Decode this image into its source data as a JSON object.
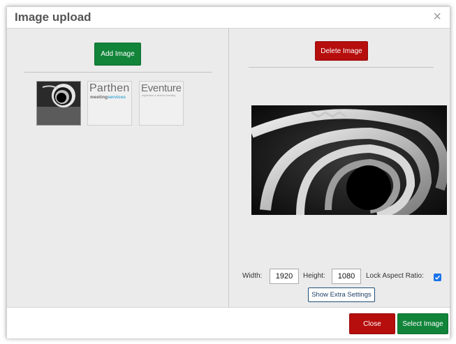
{
  "dialog": {
    "title": "Image upload",
    "close_symbol": "×"
  },
  "left": {
    "add_button": "Add Image",
    "thumbnails": [
      {
        "name": "spiral",
        "selected": true
      },
      {
        "name": "parthen",
        "line1": "Parthen",
        "line2a": "meeting",
        "line2b": "services"
      },
      {
        "name": "eventure",
        "line1": "Eventure",
        "line2": "registration & abstract handling"
      }
    ]
  },
  "right": {
    "delete_button": "Delete Image",
    "width_label": "Width:",
    "width_value": "1920",
    "height_label": "Height:",
    "height_value": "1080",
    "lock_label": "Lock Aspect Ratio:",
    "lock_checked": true,
    "extra_button": "Show Extra Settings"
  },
  "footer": {
    "close_button": "Close",
    "select_button": "Select Image"
  },
  "colors": {
    "green": "#11843a",
    "red": "#b60d0d",
    "panel_bg": "#ebebeb",
    "checkbox": "#1a73e8"
  }
}
